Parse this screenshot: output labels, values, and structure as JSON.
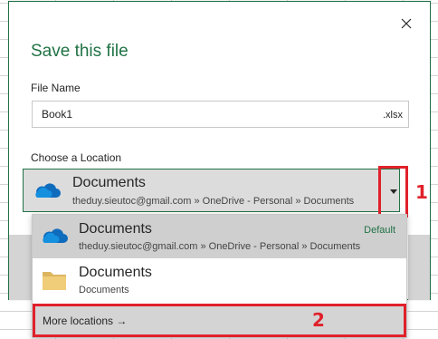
{
  "dialog": {
    "title": "Save this file",
    "close_icon": "close-icon"
  },
  "file_name": {
    "label": "File Name",
    "value": "Book1",
    "extension": ".xlsx"
  },
  "location": {
    "label": "Choose a Location",
    "selected": {
      "name": "Documents",
      "path": "theduy.sieutoc@gmail.com » OneDrive - Personal » Documents",
      "icon": "onedrive-cloud-icon"
    },
    "dropdown_icon": "caret-down-icon"
  },
  "dropdown": {
    "items": [
      {
        "name": "Documents",
        "path": "theduy.sieutoc@gmail.com » OneDrive - Personal » Documents",
        "badge": "Default",
        "icon": "onedrive-cloud-icon"
      },
      {
        "name": "Documents",
        "path": "Documents",
        "icon": "folder-icon"
      }
    ],
    "more_locations": "More locations →"
  },
  "annotations": {
    "marker_1": "1",
    "marker_2": "2"
  },
  "colors": {
    "accent": "#217346",
    "highlight": "#e0212b",
    "onedrive_blue": "#0f6cbd"
  }
}
